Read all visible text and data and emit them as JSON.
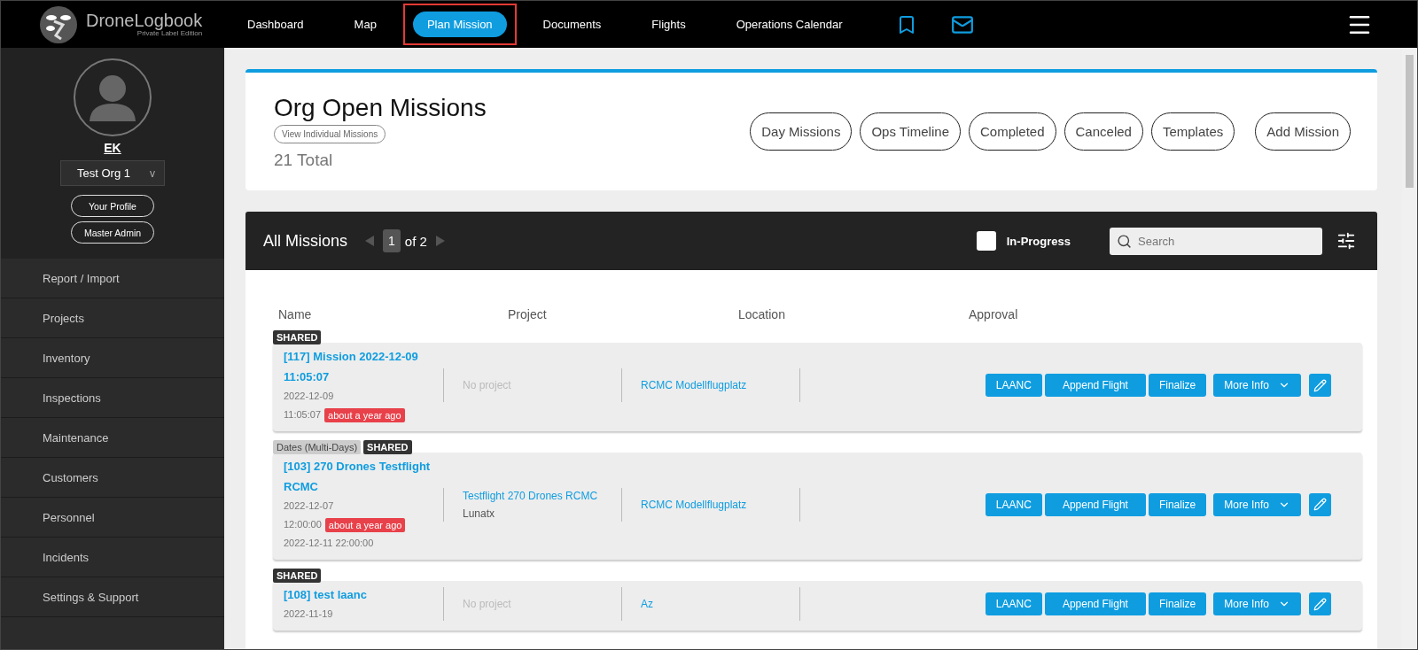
{
  "logo": {
    "name": "DroneLogbook",
    "edition": "Private Label Edition"
  },
  "nav": {
    "items": [
      {
        "label": "Dashboard",
        "selected": false,
        "highlighted": false
      },
      {
        "label": "Map",
        "selected": false,
        "highlighted": false
      },
      {
        "label": "Plan Mission",
        "selected": true,
        "highlighted": true
      },
      {
        "label": "Documents",
        "selected": false,
        "highlighted": false
      },
      {
        "label": "Flights",
        "selected": false,
        "highlighted": false
      },
      {
        "label": "Operations Calendar",
        "selected": false,
        "highlighted": false
      }
    ]
  },
  "sidebar": {
    "user": "EK",
    "org": "Test Org 1",
    "org_caret": "v",
    "buttons": [
      "Your Profile",
      "Master Admin"
    ],
    "items": [
      "Report / Import",
      "Projects",
      "Inventory",
      "Inspections",
      "Maintenance",
      "Customers",
      "Personnel",
      "Incidents",
      "Settings & Support"
    ]
  },
  "header": {
    "title": "Org Open Missions",
    "toggle": "View Individual Missions",
    "total": "21 Total",
    "buttons": [
      "Day Missions",
      "Ops Timeline",
      "Completed",
      "Canceled",
      "Templates",
      "Add Mission"
    ]
  },
  "list_bar": {
    "title": "All Missions",
    "page": "1",
    "of": "of 2",
    "in_progress": {
      "label": "In-Progress",
      "checked": false
    },
    "search": {
      "placeholder": "Search"
    }
  },
  "table": {
    "columns": [
      "Name",
      "Project",
      "Location",
      "Approval"
    ],
    "rows": [
      {
        "tags": [
          {
            "kind": "shared",
            "label": "SHARED"
          }
        ],
        "title": "[117] Mission 2022-12-09 11:05:07",
        "date": "2022-12-09",
        "time": "11:05:07",
        "age": "about a year ago",
        "project": {
          "text": "No project",
          "linked": false
        },
        "location": "RCMC Modellflugplatz",
        "actions": [
          "LAANC",
          "Append Flight",
          "Finalize",
          "More Info"
        ]
      },
      {
        "tags": [
          {
            "kind": "dates",
            "label": "Dates (Multi-Days)"
          },
          {
            "kind": "shared",
            "label": "SHARED"
          }
        ],
        "title": "[103] 270 Drones Testflight RCMC",
        "date": "2022-12-07",
        "time": "12:00:00",
        "age": "about a year ago",
        "end": "2022-12-11 22:00:00",
        "project": {
          "text": "Testflight 270 Drones RCMC",
          "linked": true,
          "owner": "Lunatx"
        },
        "location": "RCMC Modellflugplatz",
        "actions": [
          "LAANC",
          "Append Flight",
          "Finalize",
          "More Info"
        ]
      },
      {
        "tags": [
          {
            "kind": "shared",
            "label": "SHARED"
          }
        ],
        "title": "[108] test laanc",
        "date": "2022-11-19",
        "project": {
          "text": "No project",
          "linked": false
        },
        "location": "Az",
        "actions": [
          "LAANC",
          "Append Flight",
          "Finalize",
          "More Info"
        ]
      }
    ]
  }
}
